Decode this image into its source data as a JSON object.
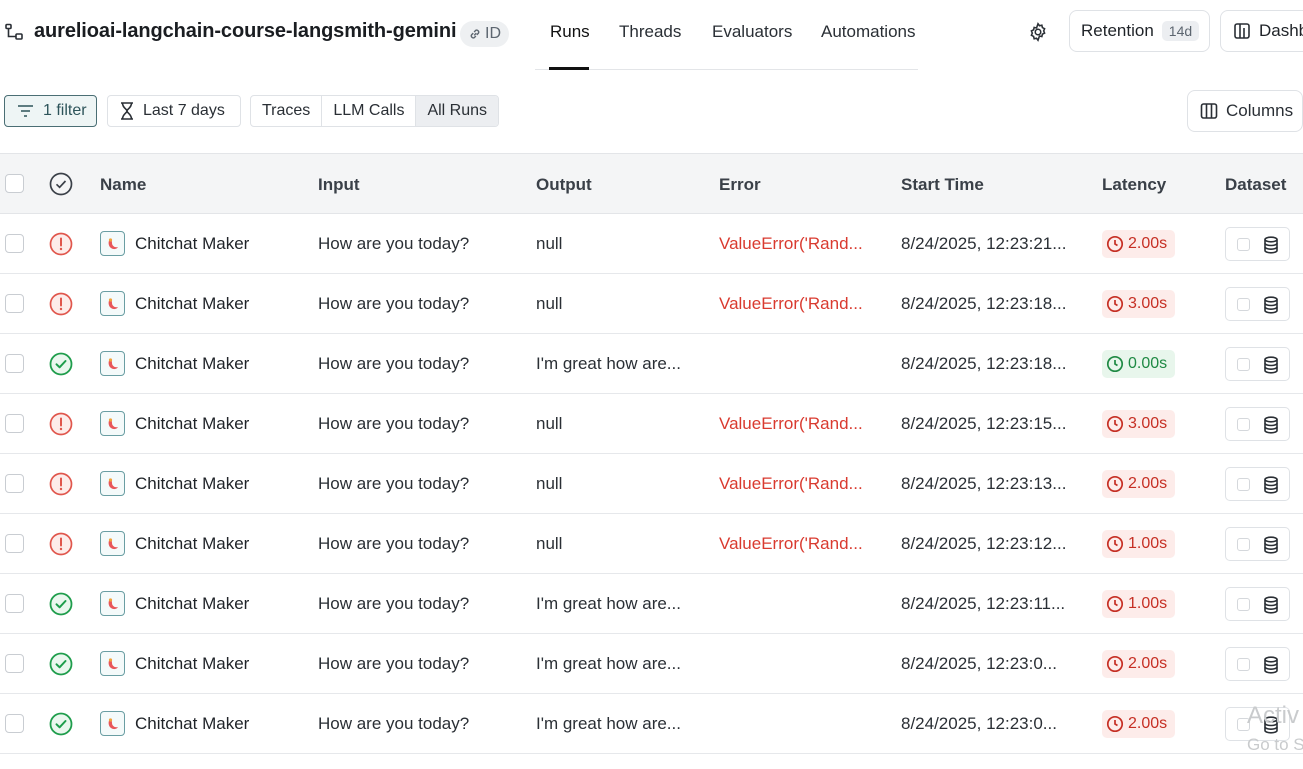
{
  "header": {
    "project_name": "aurelioai-langchain-course-langsmith-gemini",
    "id_badge": "ID",
    "tabs": [
      {
        "label": "Runs",
        "active": true
      },
      {
        "label": "Threads",
        "active": false
      },
      {
        "label": "Evaluators",
        "active": false
      },
      {
        "label": "Automations",
        "active": false
      }
    ],
    "retention_label": "Retention",
    "retention_value": "14d",
    "dashboard_label": "Dashb"
  },
  "toolbar": {
    "filter_label": "1 filter",
    "range_label": "Last 7 days",
    "segments": [
      "Traces",
      "LLM Calls",
      "All Runs"
    ],
    "active_segment": "All Runs",
    "columns_label": "Columns"
  },
  "table": {
    "headers": {
      "name": "Name",
      "input": "Input",
      "output": "Output",
      "error": "Error",
      "start_time": "Start Time",
      "latency": "Latency",
      "dataset": "Dataset"
    },
    "rows": [
      {
        "status": "error",
        "name": "Chitchat Maker",
        "input": "How are you today?",
        "output": "null",
        "error": "ValueError('Rand...",
        "start_time": "8/24/2025, 12:23:21...",
        "latency": "2.00s",
        "latency_color": "red"
      },
      {
        "status": "error",
        "name": "Chitchat Maker",
        "input": "How are you today?",
        "output": "null",
        "error": "ValueError('Rand...",
        "start_time": "8/24/2025, 12:23:18...",
        "latency": "3.00s",
        "latency_color": "red"
      },
      {
        "status": "success",
        "name": "Chitchat Maker",
        "input": "How are you today?",
        "output": "I'm great how are...",
        "error": "",
        "start_time": "8/24/2025, 12:23:18...",
        "latency": "0.00s",
        "latency_color": "green"
      },
      {
        "status": "error",
        "name": "Chitchat Maker",
        "input": "How are you today?",
        "output": "null",
        "error": "ValueError('Rand...",
        "start_time": "8/24/2025, 12:23:15...",
        "latency": "3.00s",
        "latency_color": "red"
      },
      {
        "status": "error",
        "name": "Chitchat Maker",
        "input": "How are you today?",
        "output": "null",
        "error": "ValueError('Rand...",
        "start_time": "8/24/2025, 12:23:13...",
        "latency": "2.00s",
        "latency_color": "red"
      },
      {
        "status": "error",
        "name": "Chitchat Maker",
        "input": "How are you today?",
        "output": "null",
        "error": "ValueError('Rand...",
        "start_time": "8/24/2025, 12:23:12...",
        "latency": "1.00s",
        "latency_color": "red"
      },
      {
        "status": "success",
        "name": "Chitchat Maker",
        "input": "How are you today?",
        "output": "I'm great how are...",
        "error": "",
        "start_time": "8/24/2025, 12:23:11...",
        "latency": "1.00s",
        "latency_color": "red"
      },
      {
        "status": "success",
        "name": "Chitchat Maker",
        "input": "How are you today?",
        "output": "I'm great how are...",
        "error": "",
        "start_time": "8/24/2025, 12:23:0...",
        "latency": "2.00s",
        "latency_color": "red"
      },
      {
        "status": "success",
        "name": "Chitchat Maker",
        "input": "How are you today?",
        "output": "I'm great how are...",
        "error": "",
        "start_time": "8/24/2025, 12:23:0...",
        "latency": "2.00s",
        "latency_color": "red"
      }
    ]
  },
  "watermark": {
    "line1": "Activ",
    "line2": "Go to S"
  },
  "colors": {
    "error_red": "#d93a2f",
    "success_green": "#1f9d4c",
    "filter_teal": "#4a6e74"
  }
}
